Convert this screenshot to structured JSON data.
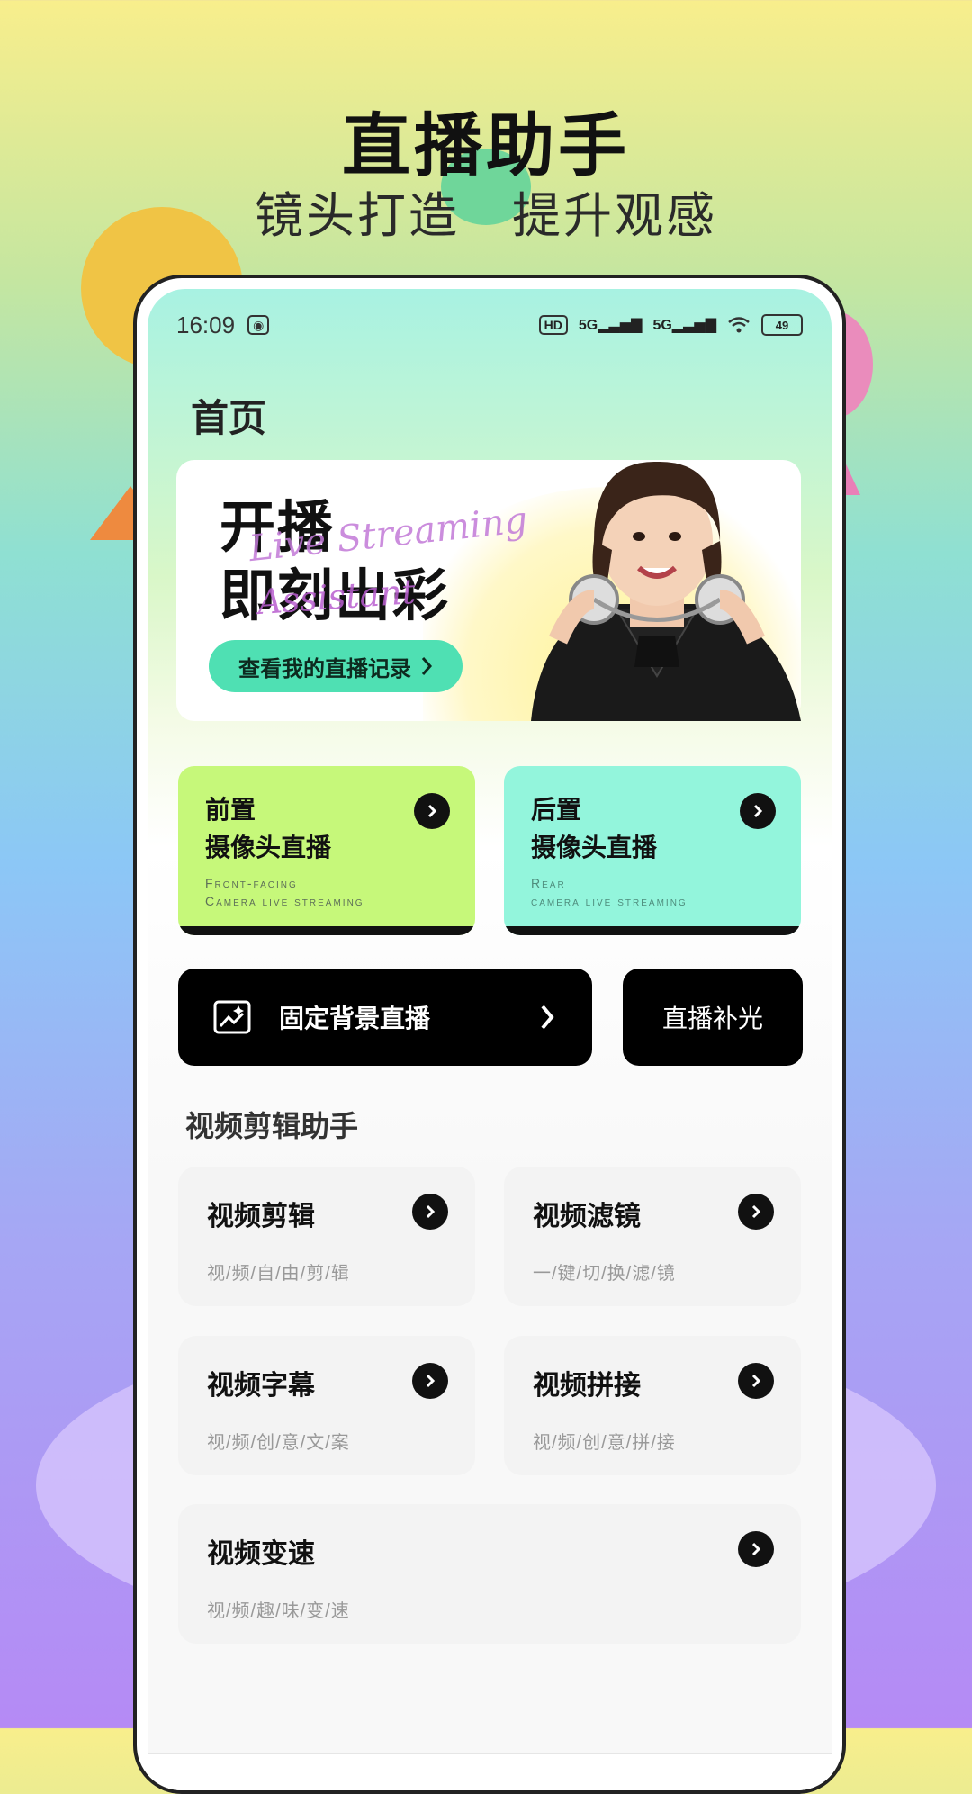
{
  "promo": {
    "title": "直播助手",
    "subtitle": "镜头打造 提升观感"
  },
  "status_bar": {
    "time": "16:09",
    "hd_label": "HD",
    "signal1": "5G",
    "signal2": "5G",
    "battery": "49"
  },
  "page": {
    "title": "首页"
  },
  "banner": {
    "headline_line1": "开播",
    "headline_line2": "即刻出彩",
    "script_line1": "Live Streaming",
    "script_line2": "Assistant",
    "button_label": "查看我的直播记录"
  },
  "camera_cards": [
    {
      "title1": "前置",
      "title2": "摄像头直播",
      "en1": "Front-facing",
      "en2": "Camera live streaming"
    },
    {
      "title1": "后置",
      "title2": "摄像头直播",
      "en1": "Rear",
      "en2": "camera live streaming"
    }
  ],
  "actions": {
    "fixed_bg": "固定背景直播",
    "fill_light": "直播补光"
  },
  "editor_section": {
    "title": "视频剪辑助手"
  },
  "tools": [
    {
      "title": "视频剪辑",
      "subtitle": "视/频/自/由/剪/辑"
    },
    {
      "title": "视频滤镜",
      "subtitle": "一/键/切/换/滤/镜"
    },
    {
      "title": "视频字幕",
      "subtitle": "视/频/创/意/文/案"
    },
    {
      "title": "视频拼接",
      "subtitle": "视/频/创/意/拼/接"
    },
    {
      "title": "视频变速",
      "subtitle": "视/频/趣/味/变/速"
    }
  ],
  "colors": {
    "front_card": "#c6f87a",
    "rear_card": "#93f5dc",
    "banner_button": "#4fe0b3",
    "dark_button": "#000000"
  }
}
